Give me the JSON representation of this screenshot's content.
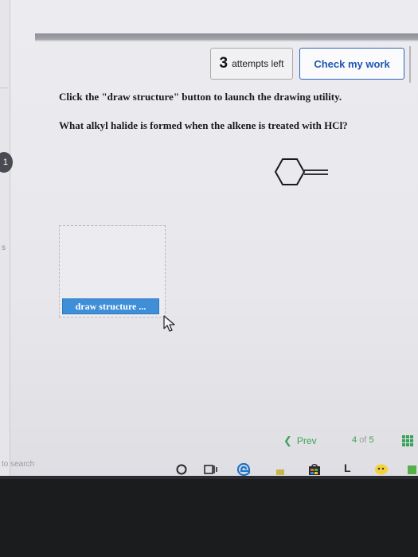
{
  "header": {
    "attempts_count": "3",
    "attempts_label": "attempts left",
    "check_button_label": "Check my work"
  },
  "question": {
    "instruction": "Click the \"draw structure\" button to launch the drawing utility.",
    "prompt": "What alkyl halide is formed when the alkene is treated with HCl?"
  },
  "drawing": {
    "button_label": "draw structure ..."
  },
  "navigation": {
    "prev_label": "Prev",
    "page_current": "4",
    "page_of": "of",
    "page_total": "5"
  },
  "left_panel": {
    "marker_label": "1",
    "letter": "s"
  },
  "taskbar": {
    "search_text": "to search",
    "letter_icon": "L"
  },
  "icons": {
    "chevron": "chevron-left-icon",
    "grid": "grid-icon",
    "cursor": "mouse-pointer-icon",
    "cortana": "cortana-circle-icon",
    "task_view": "task-view-icon",
    "edge": "edge-browser-icon",
    "store": "store-bag-icon"
  },
  "colors": {
    "accent_blue": "#1f57b0",
    "draw_button": "#3f8ed8",
    "nav_green": "#3aa35a"
  }
}
